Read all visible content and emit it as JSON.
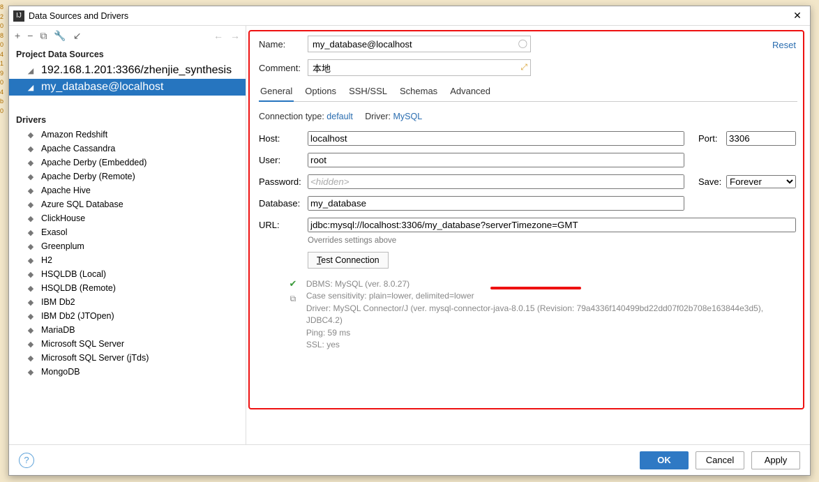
{
  "window": {
    "title": "Data Sources and Drivers"
  },
  "sidebar": {
    "section1": "Project Data Sources",
    "sources": [
      {
        "label": "192.168.1.201:3366/zhenjie_synthesis",
        "selected": false
      },
      {
        "label": "my_database@localhost",
        "selected": true
      }
    ],
    "section2": "Drivers",
    "drivers": [
      "Amazon Redshift",
      "Apache Cassandra",
      "Apache Derby (Embedded)",
      "Apache Derby (Remote)",
      "Apache Hive",
      "Azure SQL Database",
      "ClickHouse",
      "Exasol",
      "Greenplum",
      "H2",
      "HSQLDB (Local)",
      "HSQLDB (Remote)",
      "IBM Db2",
      "IBM Db2 (JTOpen)",
      "MariaDB",
      "Microsoft SQL Server",
      "Microsoft SQL Server (jTds)",
      "MongoDB"
    ]
  },
  "form": {
    "name_label": "Name:",
    "name": "my_database@localhost",
    "comment_label": "Comment:",
    "comment": "本地",
    "reset": "Reset",
    "tabs": [
      "General",
      "Options",
      "SSH/SSL",
      "Schemas",
      "Advanced"
    ],
    "conn_type_label": "Connection type:",
    "conn_type": "default",
    "driver_label": "Driver:",
    "driver": "MySQL",
    "host_label": "Host:",
    "host": "localhost",
    "port_label": "Port:",
    "port": "3306",
    "user_label": "User:",
    "user": "root",
    "password_label": "Password:",
    "password_ph": "<hidden>",
    "save_label": "Save:",
    "save": "Forever",
    "database_label": "Database:",
    "database": "my_database",
    "url_label": "URL:",
    "url": "jdbc:mysql://localhost:3306/my_database?serverTimezone=GMT",
    "override_note": "Overrides settings above",
    "test_btn": "Test Connection",
    "status": {
      "dbms": "DBMS: MySQL (ver. 8.0.27)",
      "case": "Case sensitivity: plain=lower, delimited=lower",
      "driver": "Driver: MySQL Connector/J (ver. mysql-connector-java-8.0.15 (Revision: 79a4336f140499bd22dd07f02b708e163844e3d5), JDBC4.2)",
      "ping": "Ping: 59 ms",
      "ssl": "SSL: yes"
    }
  },
  "buttons": {
    "ok": "OK",
    "cancel": "Cancel",
    "apply": "Apply"
  }
}
